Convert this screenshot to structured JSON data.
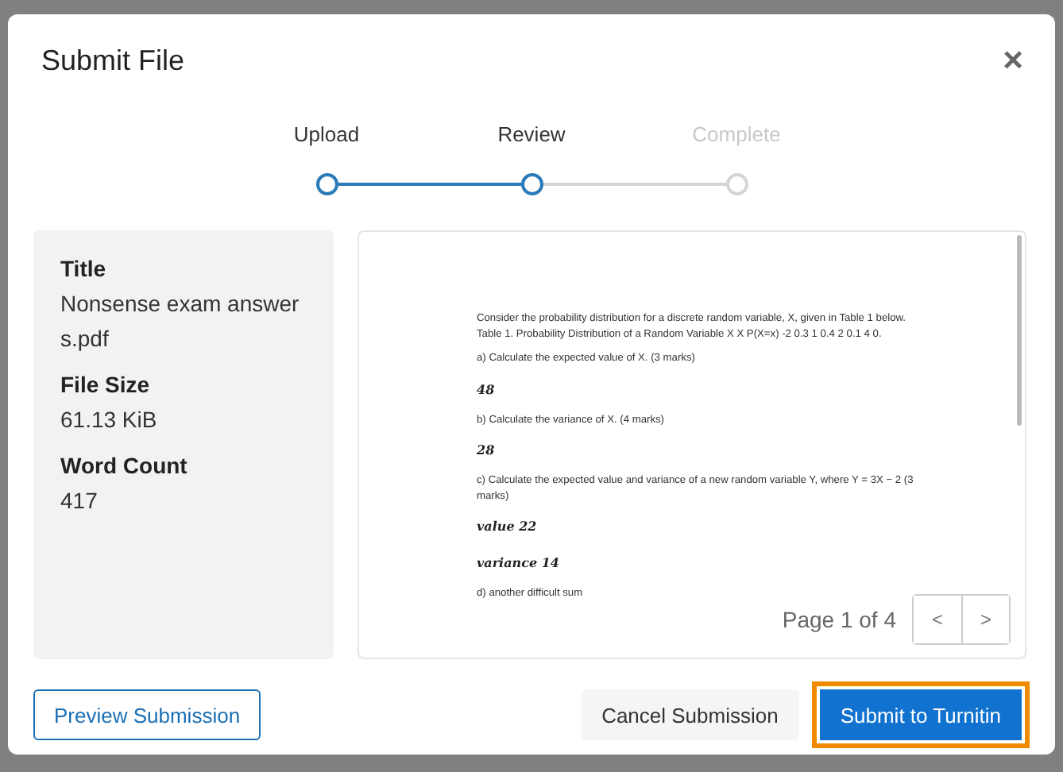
{
  "dialog": {
    "title": "Submit File",
    "close": "×"
  },
  "steps": [
    {
      "label": "Upload",
      "reached": true
    },
    {
      "label": "Review",
      "reached": true
    },
    {
      "label": "Complete",
      "reached": false
    }
  ],
  "details": [
    {
      "label": "Title",
      "value": "Nonsense exam answers.pdf"
    },
    {
      "label": "File Size",
      "value": "61.13 KiB"
    },
    {
      "label": "Word Count",
      "value": "417"
    }
  ],
  "document": {
    "blocks": [
      {
        "kind": "print",
        "text": "Consider the probability distribution for a discrete random variable, X, given in Table 1 below. Table 1. Probability Distribution of a Random Variable X X P(X=x) -2 0.3 1 0.4 2 0.1 4 0."
      },
      {
        "kind": "print",
        "text": "a) Calculate the expected value of X. (3 marks)"
      },
      {
        "kind": "handwriting",
        "text": "48"
      },
      {
        "kind": "print",
        "text": "b) Calculate  the variance of X. (4 marks)"
      },
      {
        "kind": "handwriting",
        "text": "28"
      },
      {
        "kind": "print",
        "text": "c) Calculate the expected value and variance of a new random variable Y, where Y = 3X − 2 (3 marks)"
      },
      {
        "kind": "handwriting",
        "text": "value 22"
      },
      {
        "kind": "handwriting",
        "text": "variance 14"
      },
      {
        "kind": "print",
        "text": "d) another difficult sum"
      }
    ],
    "page": "Page 1 of 4",
    "prev": "<",
    "next": ">"
  },
  "buttons": [
    {
      "label": "Preview Submission",
      "kind": "outline",
      "focused": false
    },
    {
      "label": "Cancel Submission",
      "kind": "plain",
      "focused": false
    },
    {
      "label": "Submit to Turnitin",
      "kind": "primary",
      "focused": true
    }
  ]
}
